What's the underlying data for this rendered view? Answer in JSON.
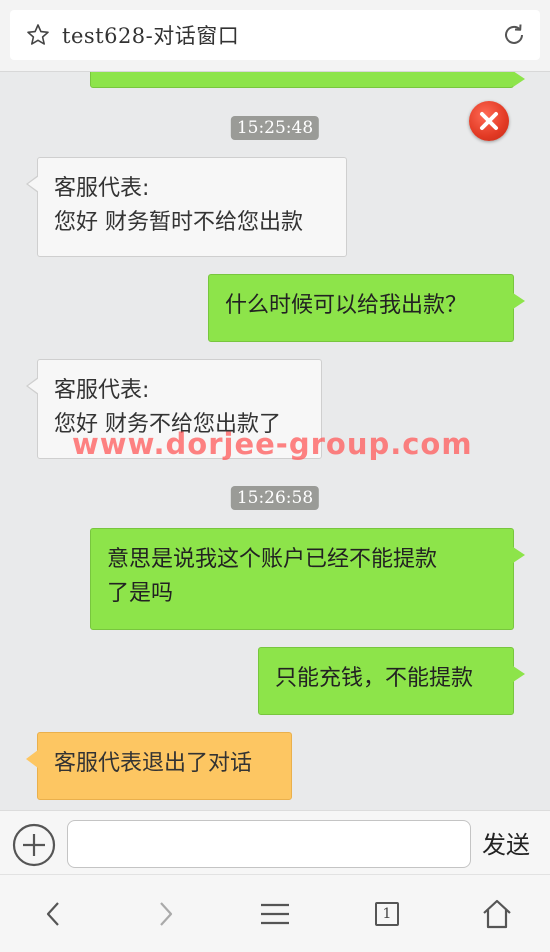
{
  "header": {
    "title": "test628-对话窗口"
  },
  "messages": [
    {
      "from": "agent",
      "sender": "客服代表:",
      "text": "您好 财务暂时不给您出款"
    },
    {
      "from": "user",
      "text": "什么时候可以给我出款？"
    },
    {
      "from": "agent",
      "sender": "客服代表:",
      "text": "您好 财务不给您出款了"
    },
    {
      "from": "user",
      "lines": [
        "意思是说我这个账户已经不能提款",
        "了是吗"
      ]
    },
    {
      "from": "user",
      "text": "只能充钱，不能提款"
    },
    {
      "from": "system",
      "text": "客服代表退出了对话"
    }
  ],
  "timestamps": [
    "15:25:48",
    "15:26:58"
  ],
  "watermark": "www.dorjee-group.com",
  "composer": {
    "placeholder": "",
    "send_label": "发送"
  },
  "browser_nav": {
    "tab_count": "1"
  },
  "colors": {
    "user_bubble": "#8de44a",
    "agent_bubble": "#f7f7f7",
    "system_bubble": "#fdc662",
    "close_button": "#e23a24"
  }
}
